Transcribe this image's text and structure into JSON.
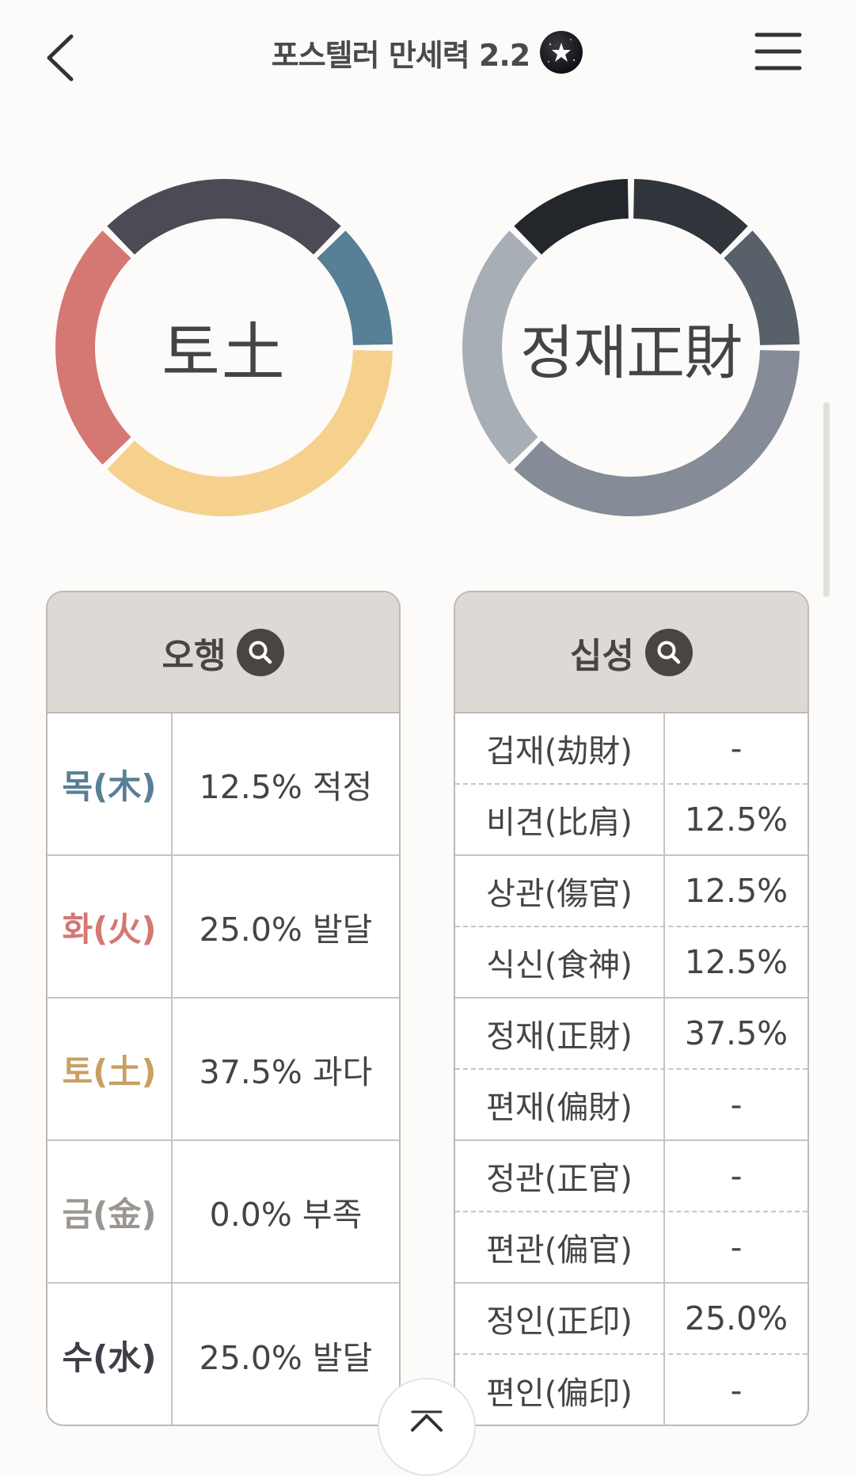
{
  "header": {
    "title": "포스텔러 만세력 2.2",
    "back_icon": "chevron-left-icon",
    "menu_icon": "hamburger-menu-icon",
    "badge_icon": "star-badge-icon"
  },
  "donut_left": {
    "label": "토土",
    "segments": [
      {
        "name": "수(水)",
        "value": 25.0,
        "color": "#4b4a55"
      },
      {
        "name": "목(木)",
        "value": 12.5,
        "color": "#577f95"
      },
      {
        "name": "토(土)",
        "value": 37.5,
        "color": "#f6d18d"
      },
      {
        "name": "화(火)",
        "value": 25.0,
        "color": "#d57773"
      }
    ]
  },
  "donut_right": {
    "label": "정재正財",
    "segments": [
      {
        "name": "비견",
        "value": 12.5,
        "color": "#2f353b"
      },
      {
        "name": "상관",
        "value": 12.5,
        "color": "#58606a"
      },
      {
        "name": "정재",
        "value": 37.5,
        "color": "#858c97"
      },
      {
        "name": "정인",
        "value": 25.0,
        "color": "#a8aeb6"
      },
      {
        "name": "식신",
        "value": 12.5,
        "color": "#23272b"
      }
    ]
  },
  "ohaeng": {
    "title": "오행",
    "rows": [
      {
        "name": "목(木)",
        "value": "12.5% 적정",
        "color": "#577f95"
      },
      {
        "name": "화(火)",
        "value": "25.0% 발달",
        "color": "#d57773"
      },
      {
        "name": "토(土)",
        "value": "37.5% 과다",
        "color": "#c9a063"
      },
      {
        "name": "금(金)",
        "value": "0.0% 부족",
        "color": "#9a9590"
      },
      {
        "name": "수(水)",
        "value": "25.0% 발달",
        "color": "#3f3e48"
      }
    ]
  },
  "sipsung": {
    "title": "십성",
    "rows": [
      {
        "name": "겁재(劫財)",
        "value": "-"
      },
      {
        "name": "비견(比肩)",
        "value": "12.5%"
      },
      {
        "name": "상관(傷官)",
        "value": "12.5%"
      },
      {
        "name": "식신(食神)",
        "value": "12.5%"
      },
      {
        "name": "정재(正財)",
        "value": "37.5%"
      },
      {
        "name": "편재(偏財)",
        "value": "-"
      },
      {
        "name": "정관(正官)",
        "value": "-"
      },
      {
        "name": "편관(偏官)",
        "value": "-"
      },
      {
        "name": "정인(正印)",
        "value": "25.0%"
      },
      {
        "name": "편인(偏印)",
        "value": "-"
      }
    ]
  },
  "scroll_top_icon": "chevron-up-icon",
  "search_icon": "search-icon"
}
